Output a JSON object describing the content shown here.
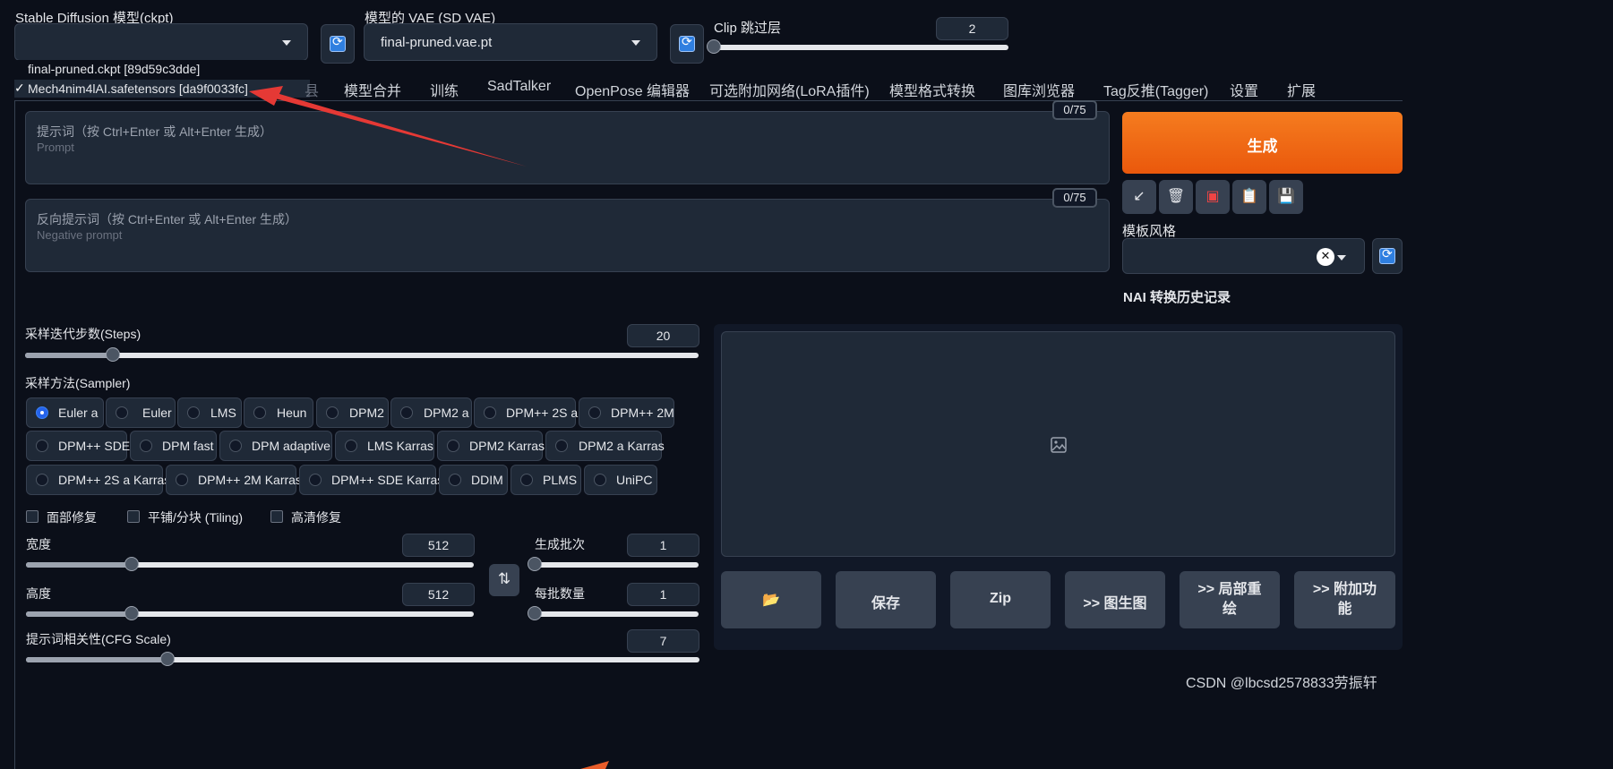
{
  "top": {
    "ckpt_label": "Stable Diffusion 模型(ckpt)",
    "ckpt_value": "",
    "vae_label": "模型的 VAE (SD VAE)",
    "vae_value": "final-pruned.vae.pt",
    "clip_label": "Clip 跳过层",
    "clip_value": "2",
    "clip_fraction": 0.0
  },
  "dropdown": {
    "options": [
      {
        "label": "final-pruned.ckpt [89d59c3dde]",
        "check": ""
      },
      {
        "label": "Mech4nim4lAI.safetensors [da9f0033fc]",
        "check": "✓"
      }
    ],
    "annotation_color": "#e53935"
  },
  "tabs": [
    "模型合并",
    "训练",
    "SadTalker",
    "OpenPose 编辑器",
    "可选附加网络(LoRA插件)",
    "模型格式转换",
    "图库浏览器",
    "Tag反推(Tagger)",
    "设置",
    "扩展"
  ],
  "tab_fragment": "县",
  "prompt": {
    "hint": "提示词（按 Ctrl+Enter 或 Alt+Enter 生成）",
    "placeholder": "Prompt",
    "counter": "0/75"
  },
  "negative_prompt": {
    "hint": "反向提示词（按 Ctrl+Enter 或 Alt+Enter 生成）",
    "placeholder": "Negative prompt",
    "counter": "0/75"
  },
  "generate": {
    "label": "生成",
    "color": "#f4731a"
  },
  "tool_icons": [
    "arrow-icon",
    "trash-icon",
    "red-card-icon",
    "clipboard-icon",
    "save-icon"
  ],
  "style": {
    "label": "模板风格",
    "clear": "✕",
    "nai_label": "NAI 转换历史记录"
  },
  "steps": {
    "label": "采样迭代步数(Steps)",
    "value": "20",
    "fraction": 0.13
  },
  "sampler": {
    "label": "采样方法(Sampler)",
    "selected": "Euler a",
    "rows": [
      [
        "Euler a",
        "Euler",
        "LMS",
        "Heun",
        "DPM2",
        "DPM2 a",
        "DPM++ 2S a",
        "DPM++ 2M"
      ],
      [
        "DPM++ SDE",
        "DPM fast",
        "DPM adaptive",
        "LMS Karras",
        "DPM2 Karras",
        "DPM2 a Karras"
      ],
      [
        "DPM++ 2S a Karras",
        "DPM++ 2M Karras",
        "DPM++ SDE Karras",
        "DDIM",
        "PLMS",
        "UniPC"
      ]
    ]
  },
  "checkboxes": [
    "面部修复",
    "平铺/分块 (Tiling)",
    "高清修复"
  ],
  "width": {
    "label": "宽度",
    "value": "512",
    "fraction": 0.235
  },
  "height": {
    "label": "高度",
    "value": "512",
    "fraction": 0.235
  },
  "swap_icon": "⇅",
  "batch_count": {
    "label": "生成批次",
    "value": "1",
    "fraction": 0.0
  },
  "batch_size": {
    "label": "每批数量",
    "value": "1",
    "fraction": 0.0
  },
  "cfg": {
    "label": "提示词相关性(CFG Scale)",
    "value": "7",
    "fraction": 0.21
  },
  "output_actions": {
    "folder": "📂",
    "save": "保存",
    "zip": "Zip",
    "img2img": ">> 图生图",
    "inpaint": ">> 局部重绘",
    "extras": ">> 附加功能"
  },
  "watermark": "CSDN @lbcsd2578833劳振轩"
}
